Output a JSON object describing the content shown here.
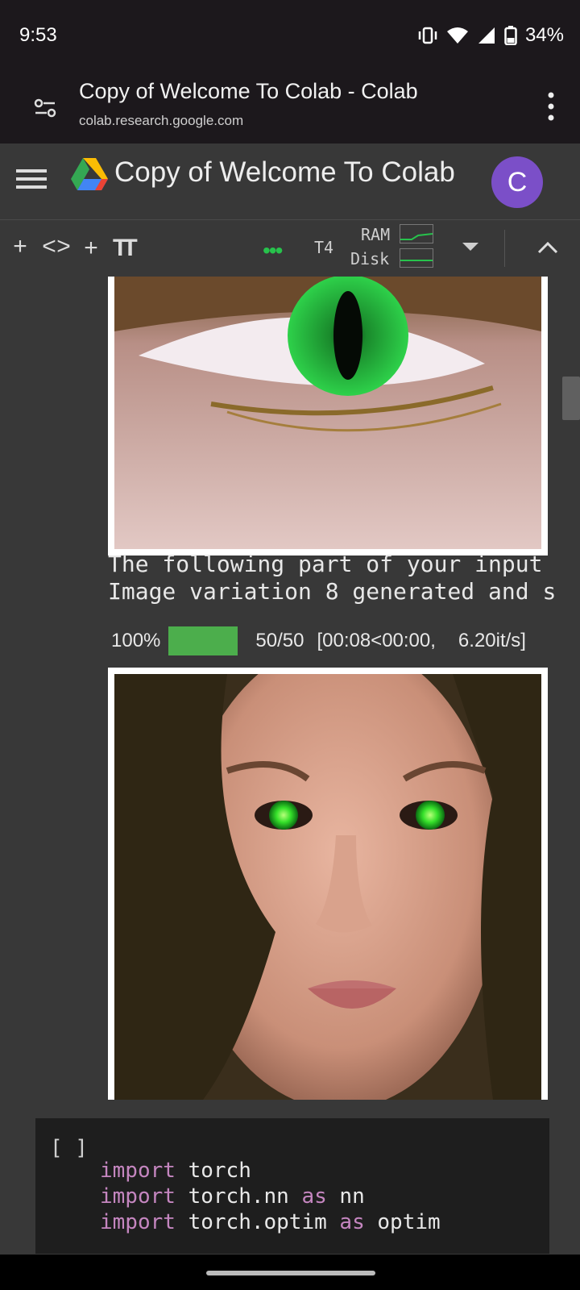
{
  "status_bar": {
    "time": "9:53",
    "battery": "34%"
  },
  "browser": {
    "page_title": "Copy of Welcome To Colab - Colab",
    "url": "colab.research.google.com"
  },
  "colab": {
    "notebook_title": "Copy of Welcome To Colab",
    "avatar_letter": "C"
  },
  "toolbar": {
    "add_code": "+ <>",
    "add_text": "+ ",
    "text_icon": "TT",
    "runtime_status": "•••",
    "runtime_type": "T4",
    "ram_label": "RAM",
    "disk_label": "Disk"
  },
  "output": {
    "line1": "The following part of your input",
    "line2": "Image variation 8 generated and s",
    "progress": {
      "percent_label": "100%",
      "percent_value": 100,
      "steps": "50/50",
      "timing": "[00:08<00:00,",
      "rate": "6.20it/s]"
    }
  },
  "code_cell": {
    "run_indicator": "[ ]",
    "lines": [
      {
        "kw": "import",
        "rest": " torch"
      },
      {
        "kw": "import",
        "rest": " torch.nn ",
        "kw2": "as",
        "rest2": " nn"
      },
      {
        "kw": "import",
        "rest": " torch.optim ",
        "kw2": "as",
        "rest2": " optim"
      }
    ]
  },
  "icons": {
    "tune": "tune-icon",
    "menu": "more-vert-icon",
    "hamburger": "menu-icon",
    "drive": "google-drive-icon",
    "chevron_up": "chevron-up-icon",
    "caret_down": "dropdown-caret-icon"
  },
  "colors": {
    "accent_green": "#27c24c",
    "progress_green": "#4cae4c",
    "avatar_purple": "#7b4fc8",
    "keyword_pink": "#c586c0"
  }
}
